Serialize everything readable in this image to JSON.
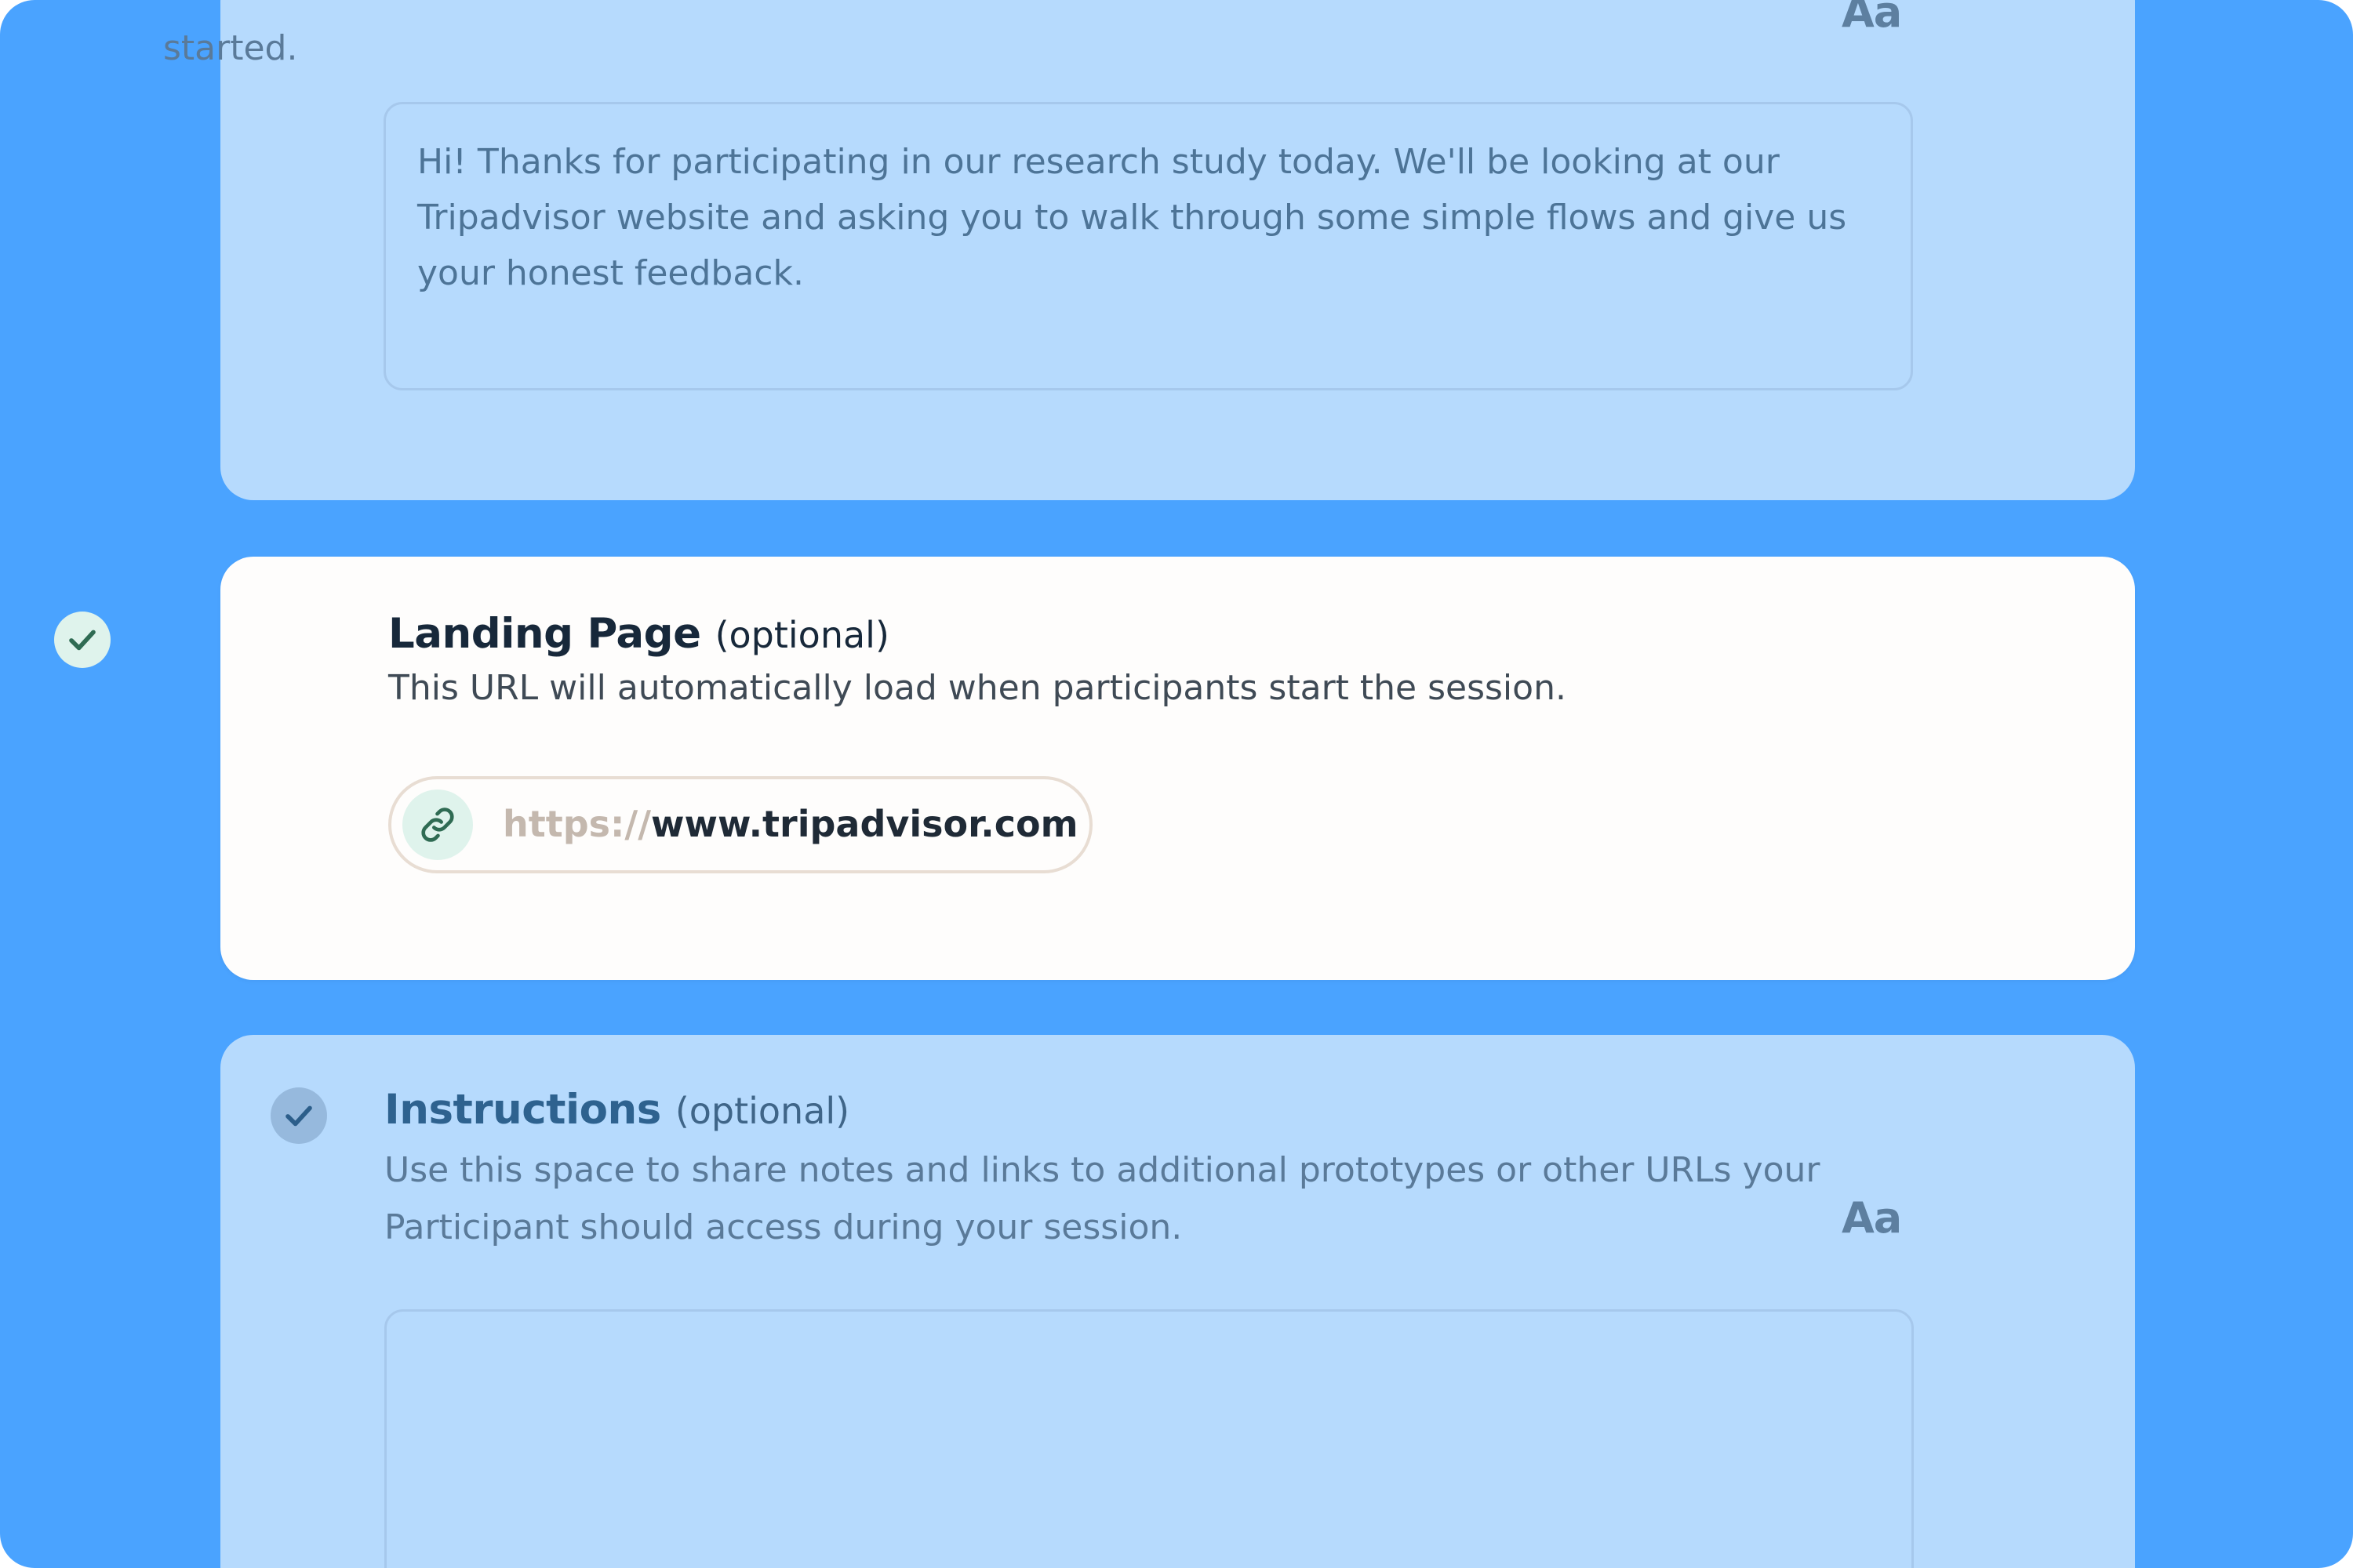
{
  "welcome": {
    "description_tail": "started.",
    "format_icon": "Aa",
    "message": "Hi! Thanks for participating in our research study today. We'll be looking at our Tripadvisor website and asking you to walk through some simple flows and give us your honest feedback."
  },
  "landing_page": {
    "title": "Landing Page",
    "optional_label": "(optional)",
    "description": "This URL will automatically load when participants start the session.",
    "url_prefix": "https://",
    "url_value": "www.tripadvisor.com",
    "status_icon": "check-icon",
    "link_icon": "link-icon"
  },
  "instructions": {
    "title": "Instructions",
    "optional_label": "(optional)",
    "description": "Use this space to share notes and links to additional prototypes or other URLs your Participant should access during your session.",
    "format_icon": "Aa",
    "message": "",
    "status_icon": "check-icon"
  },
  "colors": {
    "background": "#4aa3ff",
    "faded_card": "#b6dafd",
    "active_card": "#fefdfc",
    "check_active": "#2f6b53",
    "check_faded": "#2c5e8a"
  }
}
